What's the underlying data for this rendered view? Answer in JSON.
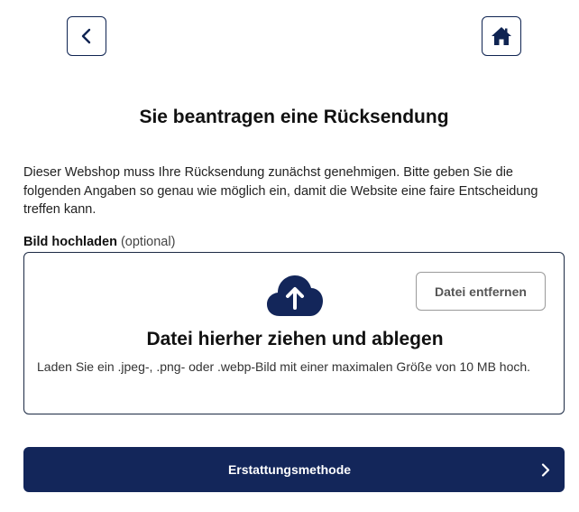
{
  "nav": {
    "back_icon": "chevron-left-icon",
    "home_icon": "home-icon"
  },
  "page": {
    "title": "Sie beantragen eine Rücksendung",
    "intro": "Dieser Webshop muss Ihre Rücksendung zunächst genehmigen. Bitte geben Sie die folgenden Angaben so genau wie möglich ein, damit die Website eine faire Entscheidung treffen kann."
  },
  "upload": {
    "label": "Bild hochladen",
    "optional": "(optional)",
    "remove_label": "Datei entfernen",
    "icon": "cloud-upload-icon",
    "drop_title": "Datei hierher ziehen und ablegen",
    "hint": "Laden Sie ein .jpeg-, .png- oder .webp-Bild mit einer maximalen Größe von 10 MB hoch."
  },
  "footer": {
    "next_label": "Erstattungsmethode",
    "next_icon": "chevron-right-icon"
  },
  "colors": {
    "primary": "#13265a",
    "border": "#1c2a44"
  }
}
